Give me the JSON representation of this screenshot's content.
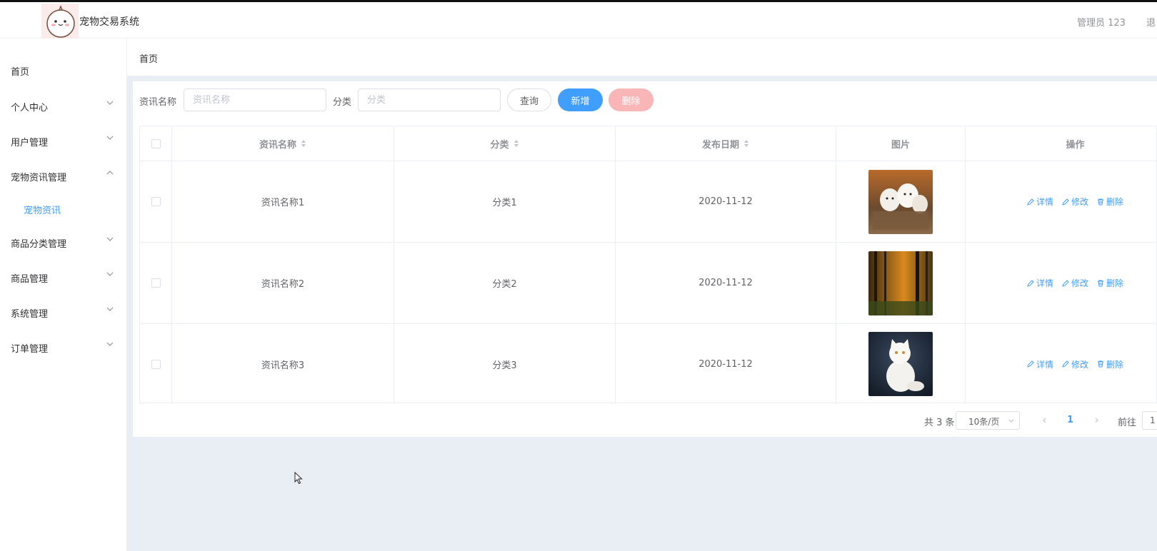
{
  "header": {
    "title": "宠物交易系统",
    "admin": "管理员 123",
    "logout": "退"
  },
  "sidebar": {
    "items": [
      {
        "label": "首页"
      },
      {
        "label": "个人中心"
      },
      {
        "label": "用户管理"
      },
      {
        "label": "宠物资讯管理"
      },
      {
        "label": "宠物资讯"
      },
      {
        "label": "商品分类管理"
      },
      {
        "label": "商品管理"
      },
      {
        "label": "系统管理"
      },
      {
        "label": "订单管理"
      }
    ]
  },
  "breadcrumb": "首页",
  "search": {
    "name_label": "资讯名称",
    "name_placeholder": "资讯名称",
    "category_label": "分类",
    "category_placeholder": "分类",
    "query_button": "查询",
    "add_button": "新增",
    "delete_button": "删除"
  },
  "table": {
    "columns": [
      "资讯名称",
      "分类",
      "发布日期",
      "图片",
      "操作"
    ],
    "rows": [
      {
        "name": "资讯名称1",
        "category": "分类1",
        "date": "2020-11-12"
      },
      {
        "name": "资讯名称2",
        "category": "分类2",
        "date": "2020-11-12"
      },
      {
        "name": "资讯名称3",
        "category": "分类3",
        "date": "2020-11-12"
      }
    ],
    "actions": {
      "detail": "详情",
      "edit": "修改",
      "delete": "删除"
    }
  },
  "pagination": {
    "total": "共 3 条",
    "page_size": "10条/页",
    "current_page": "1",
    "goto_label": "前往",
    "goto_value": "1"
  },
  "colors": {
    "primary": "#409eff",
    "danger_disabled": "#fab6b6",
    "content_bg": "#e9edf4"
  }
}
